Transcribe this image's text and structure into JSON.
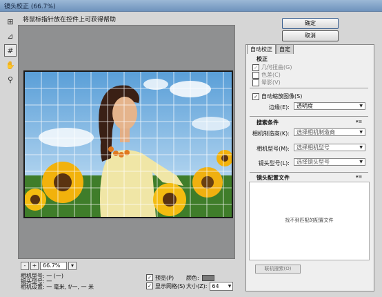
{
  "window": {
    "title": "镜头校正 (66.7%)"
  },
  "hint": "将鼠标指针放在控件上可获得帮助",
  "tools": [
    "remove-distortion-icon",
    "straighten-icon",
    "grid-icon",
    "hand-icon",
    "zoom-icon"
  ],
  "zoom": {
    "value": "66.7%",
    "minus": "-",
    "plus": "+"
  },
  "camera_info": {
    "model": "相机型号: 一 (一)",
    "lens": "镜头型号: 一",
    "settings": "相机设置: 一 毫米, f/一, 一 米"
  },
  "bottom": {
    "preview_label": "预览(P)",
    "grid_label": "显示网格(S)",
    "color_label": "颜色:",
    "color_value": "#7a7a7a",
    "size_label": "大小(Z):",
    "size_value": "64"
  },
  "buttons": {
    "ok": "确定",
    "cancel": "取消"
  },
  "tabs": [
    "自动校正",
    "自定"
  ],
  "correction": {
    "title": "校正",
    "geometric": "几何扭曲(G)",
    "ca": "色差(C)",
    "vignette": "晕影(V)",
    "auto_scale": "自动缩放图像(S)",
    "edge_label": "边缘(E):",
    "edge_value": "透明度"
  },
  "search": {
    "title": "搜索条件",
    "make_label": "相机制造商(K):",
    "make_value": "选择相机制造商",
    "model_label": "相机型号(M):",
    "model_value": "选择相机型号",
    "lens_label": "镜头型号(L):",
    "lens_value": "选择镜头型号"
  },
  "profiles": {
    "title": "镜头配置文件",
    "empty": "找不到匹配的配置文件",
    "online_button": "联机搜索(O)"
  }
}
